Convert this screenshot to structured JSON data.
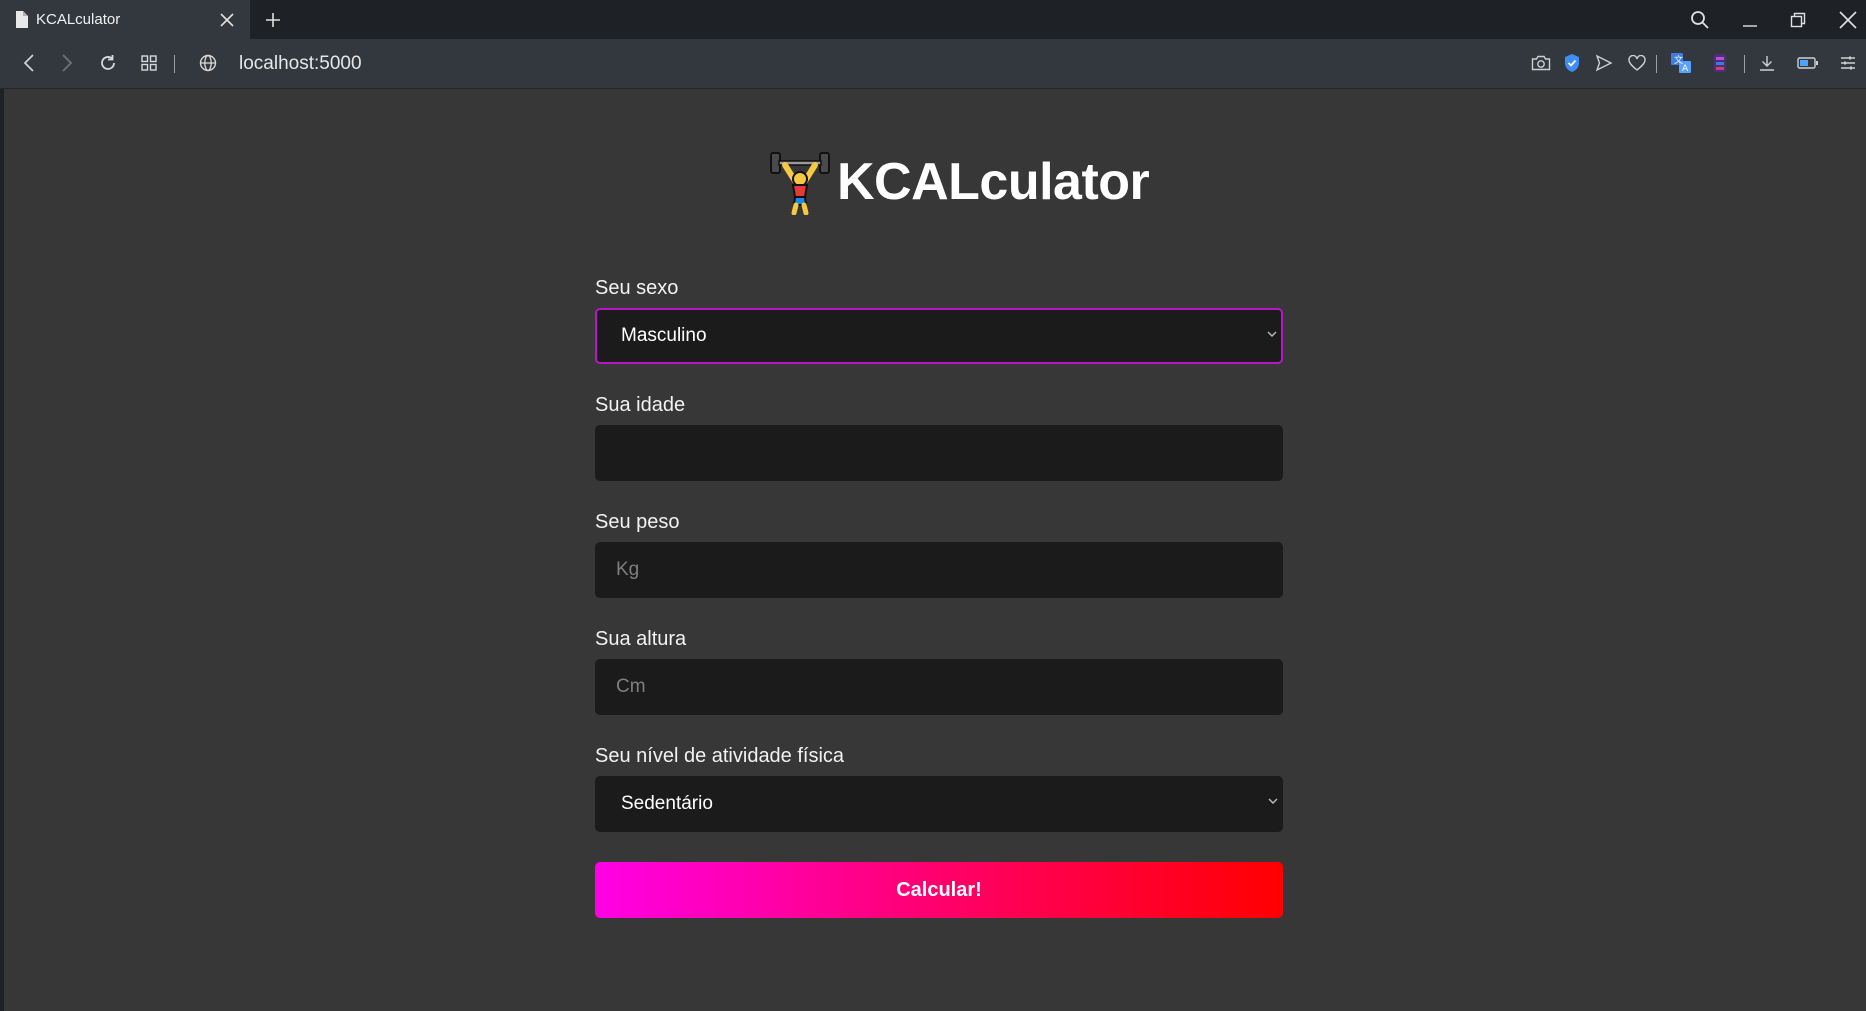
{
  "browser": {
    "tab_title": "KCALculator",
    "url": "localhost:5000"
  },
  "app": {
    "title": "KCALculator",
    "logo_icon": "weightlifter-emoji"
  },
  "form": {
    "sex": {
      "label": "Seu sexo",
      "value": "Masculino"
    },
    "age": {
      "label": "Sua idade",
      "value": "",
      "placeholder": ""
    },
    "weight": {
      "label": "Seu peso",
      "value": "",
      "placeholder": "Kg"
    },
    "height": {
      "label": "Sua altura",
      "value": "",
      "placeholder": "Cm"
    },
    "activity": {
      "label": "Seu nível de atividade física",
      "value": "Sedentário"
    },
    "submit_label": "Calcular!"
  },
  "colors": {
    "page_bg": "#373737",
    "input_bg": "#1b1b1c",
    "focus_border": "#b616c8",
    "button_gradient_start": "#ff00e6",
    "button_gradient_end": "#ff0000"
  }
}
